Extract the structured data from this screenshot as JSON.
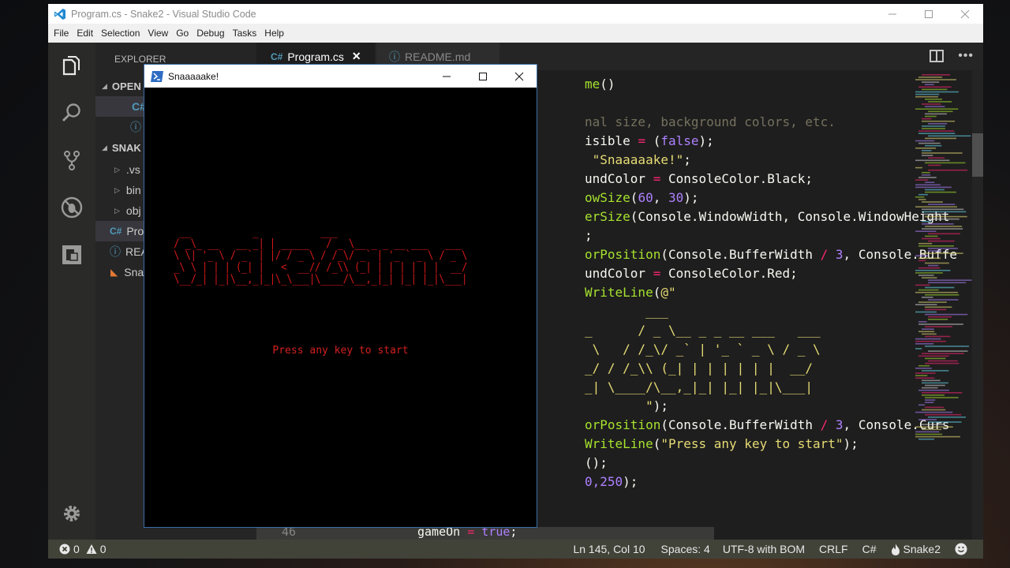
{
  "window": {
    "title": "Program.cs - Snake2 - Visual Studio Code",
    "controls": [
      "minimize",
      "maximize",
      "close"
    ]
  },
  "menu": [
    "File",
    "Edit",
    "Selection",
    "View",
    "Go",
    "Debug",
    "Tasks",
    "Help"
  ],
  "activity_bar": [
    "explorer-icon",
    "search-icon",
    "source-control-icon",
    "debug-icon",
    "extensions-icon",
    "settings-icon"
  ],
  "sidebar": {
    "header": "EXPLORER",
    "open_editors_label": "OPEN",
    "project_label": "SNAK",
    "items": [
      ".vs",
      "bin",
      "obj",
      "Pro",
      "REA",
      "Sna"
    ]
  },
  "tabs": [
    {
      "label": "Program.cs",
      "active": true,
      "icon": "csharp-icon"
    },
    {
      "label": "README.md",
      "active": false,
      "icon": "info-icon"
    }
  ],
  "code_lines": [
    {
      "parts": [
        [
          "fn",
          "me"
        ],
        [
          "txt",
          "()"
        ]
      ]
    },
    {
      "parts": [
        [
          "cm",
          "nal size, background colors, etc."
        ]
      ]
    },
    {
      "parts": [
        [
          "txt",
          "isible "
        ],
        [
          "op",
          "="
        ],
        [
          "txt",
          " ("
        ],
        [
          "kw",
          "false"
        ],
        [
          "txt",
          ");"
        ]
      ]
    },
    {
      "parts": [
        [
          "str",
          " \"Snaaaaake!\""
        ],
        [
          "txt",
          ";"
        ]
      ]
    },
    {
      "parts": [
        [
          "txt",
          "undColor "
        ],
        [
          "op",
          "="
        ],
        [
          "txt",
          " ConsoleColor.Black;"
        ]
      ]
    },
    {
      "parts": [
        [
          "fn",
          "owSize"
        ],
        [
          "txt",
          "("
        ],
        [
          "num",
          "60"
        ],
        [
          "txt",
          ", "
        ],
        [
          "num",
          "30"
        ],
        [
          "txt",
          ");"
        ]
      ]
    },
    {
      "parts": [
        [
          "fn",
          "erSize"
        ],
        [
          "txt",
          "(Console.WindowWidth, Console.WindowHeight"
        ]
      ]
    },
    {
      "parts": [
        [
          "txt",
          ";"
        ]
      ]
    },
    {
      "parts": [
        [
          "fn",
          "orPosition"
        ],
        [
          "txt",
          "(Console.BufferWidth "
        ],
        [
          "op",
          "/"
        ],
        [
          "txt",
          " "
        ],
        [
          "num",
          "3"
        ],
        [
          "txt",
          ", Console.Buffe"
        ]
      ]
    },
    {
      "parts": [
        [
          "txt",
          "undColor "
        ],
        [
          "op",
          "="
        ],
        [
          "txt",
          " ConsoleColor.Red;"
        ]
      ]
    },
    {
      "parts": [
        [
          "fn",
          "WriteLine"
        ],
        [
          "txt",
          "("
        ],
        [
          "str",
          "@\""
        ]
      ]
    },
    {
      "parts": [
        [
          "str",
          "        ___"
        ]
      ]
    },
    {
      "parts": [
        [
          "str",
          "_      / _ \\__ _ _ __ ___   ___"
        ]
      ]
    },
    {
      "parts": [
        [
          "str",
          " \\   / /_\\/ _` | '_ ` _ \\ / _ \\"
        ]
      ]
    },
    {
      "parts": [
        [
          "str",
          "_/ / /_\\\\ (_| | | | | | |  __/"
        ]
      ]
    },
    {
      "parts": [
        [
          "str",
          "_| \\____/\\__,_|_| |_| |_|\\___|"
        ]
      ]
    },
    {
      "parts": [
        [
          "str",
          "        \""
        ],
        [
          "txt",
          ");"
        ]
      ]
    },
    {
      "parts": [
        [
          "fn",
          "orPosition"
        ],
        [
          "txt",
          "(Console.BufferWidth "
        ],
        [
          "op",
          "/"
        ],
        [
          "txt",
          " "
        ],
        [
          "num",
          "3"
        ],
        [
          "txt",
          ", Console.Curs"
        ]
      ]
    },
    {
      "parts": [
        [
          "fn",
          "WriteLine"
        ],
        [
          "txt",
          "("
        ],
        [
          "str",
          "\"Press any key to start\""
        ],
        [
          "txt",
          ");"
        ]
      ]
    },
    {
      "parts": [
        [
          "txt",
          "();"
        ]
      ]
    },
    {
      "parts": [
        [
          "num",
          "0,250"
        ],
        [
          "txt",
          ");"
        ]
      ]
    }
  ],
  "bottom_line": {
    "line_number": "46",
    "text_var": "gameOn",
    "text_op": "=",
    "text_val": "true",
    "text_end": ";"
  },
  "status": {
    "errors": "0",
    "warnings": "0",
    "position": "Ln 145, Col 10",
    "spaces": "Spaces: 4",
    "encoding": "UTF-8 with BOM",
    "eol": "CRLF",
    "language": "C#",
    "project": "Snake2"
  },
  "console_window": {
    "title": "Snaaaaake!",
    "ascii_art": "  __           _           ___\n / _\\_ __   __ _| | _____   / _ \\__ _ _ __ ___   ___\n \\ \\| '_ \\ / _` | |/ / _ \\ / /_\\/ _` | '_ ` _ \\ / _ \\\n _\\ \\ | | | (_| |   <  __// /_\\\\ (_| | | | | | |  __/\n \\__/_| |_|\\__,_|_|\\_\\___|\\____/\\__,_|_| |_| |_|\\___|",
    "prompt": "Press any key to start"
  },
  "colors": {
    "accent": "#007acc",
    "console_text": "#d41818",
    "statusbar": "#414339"
  }
}
